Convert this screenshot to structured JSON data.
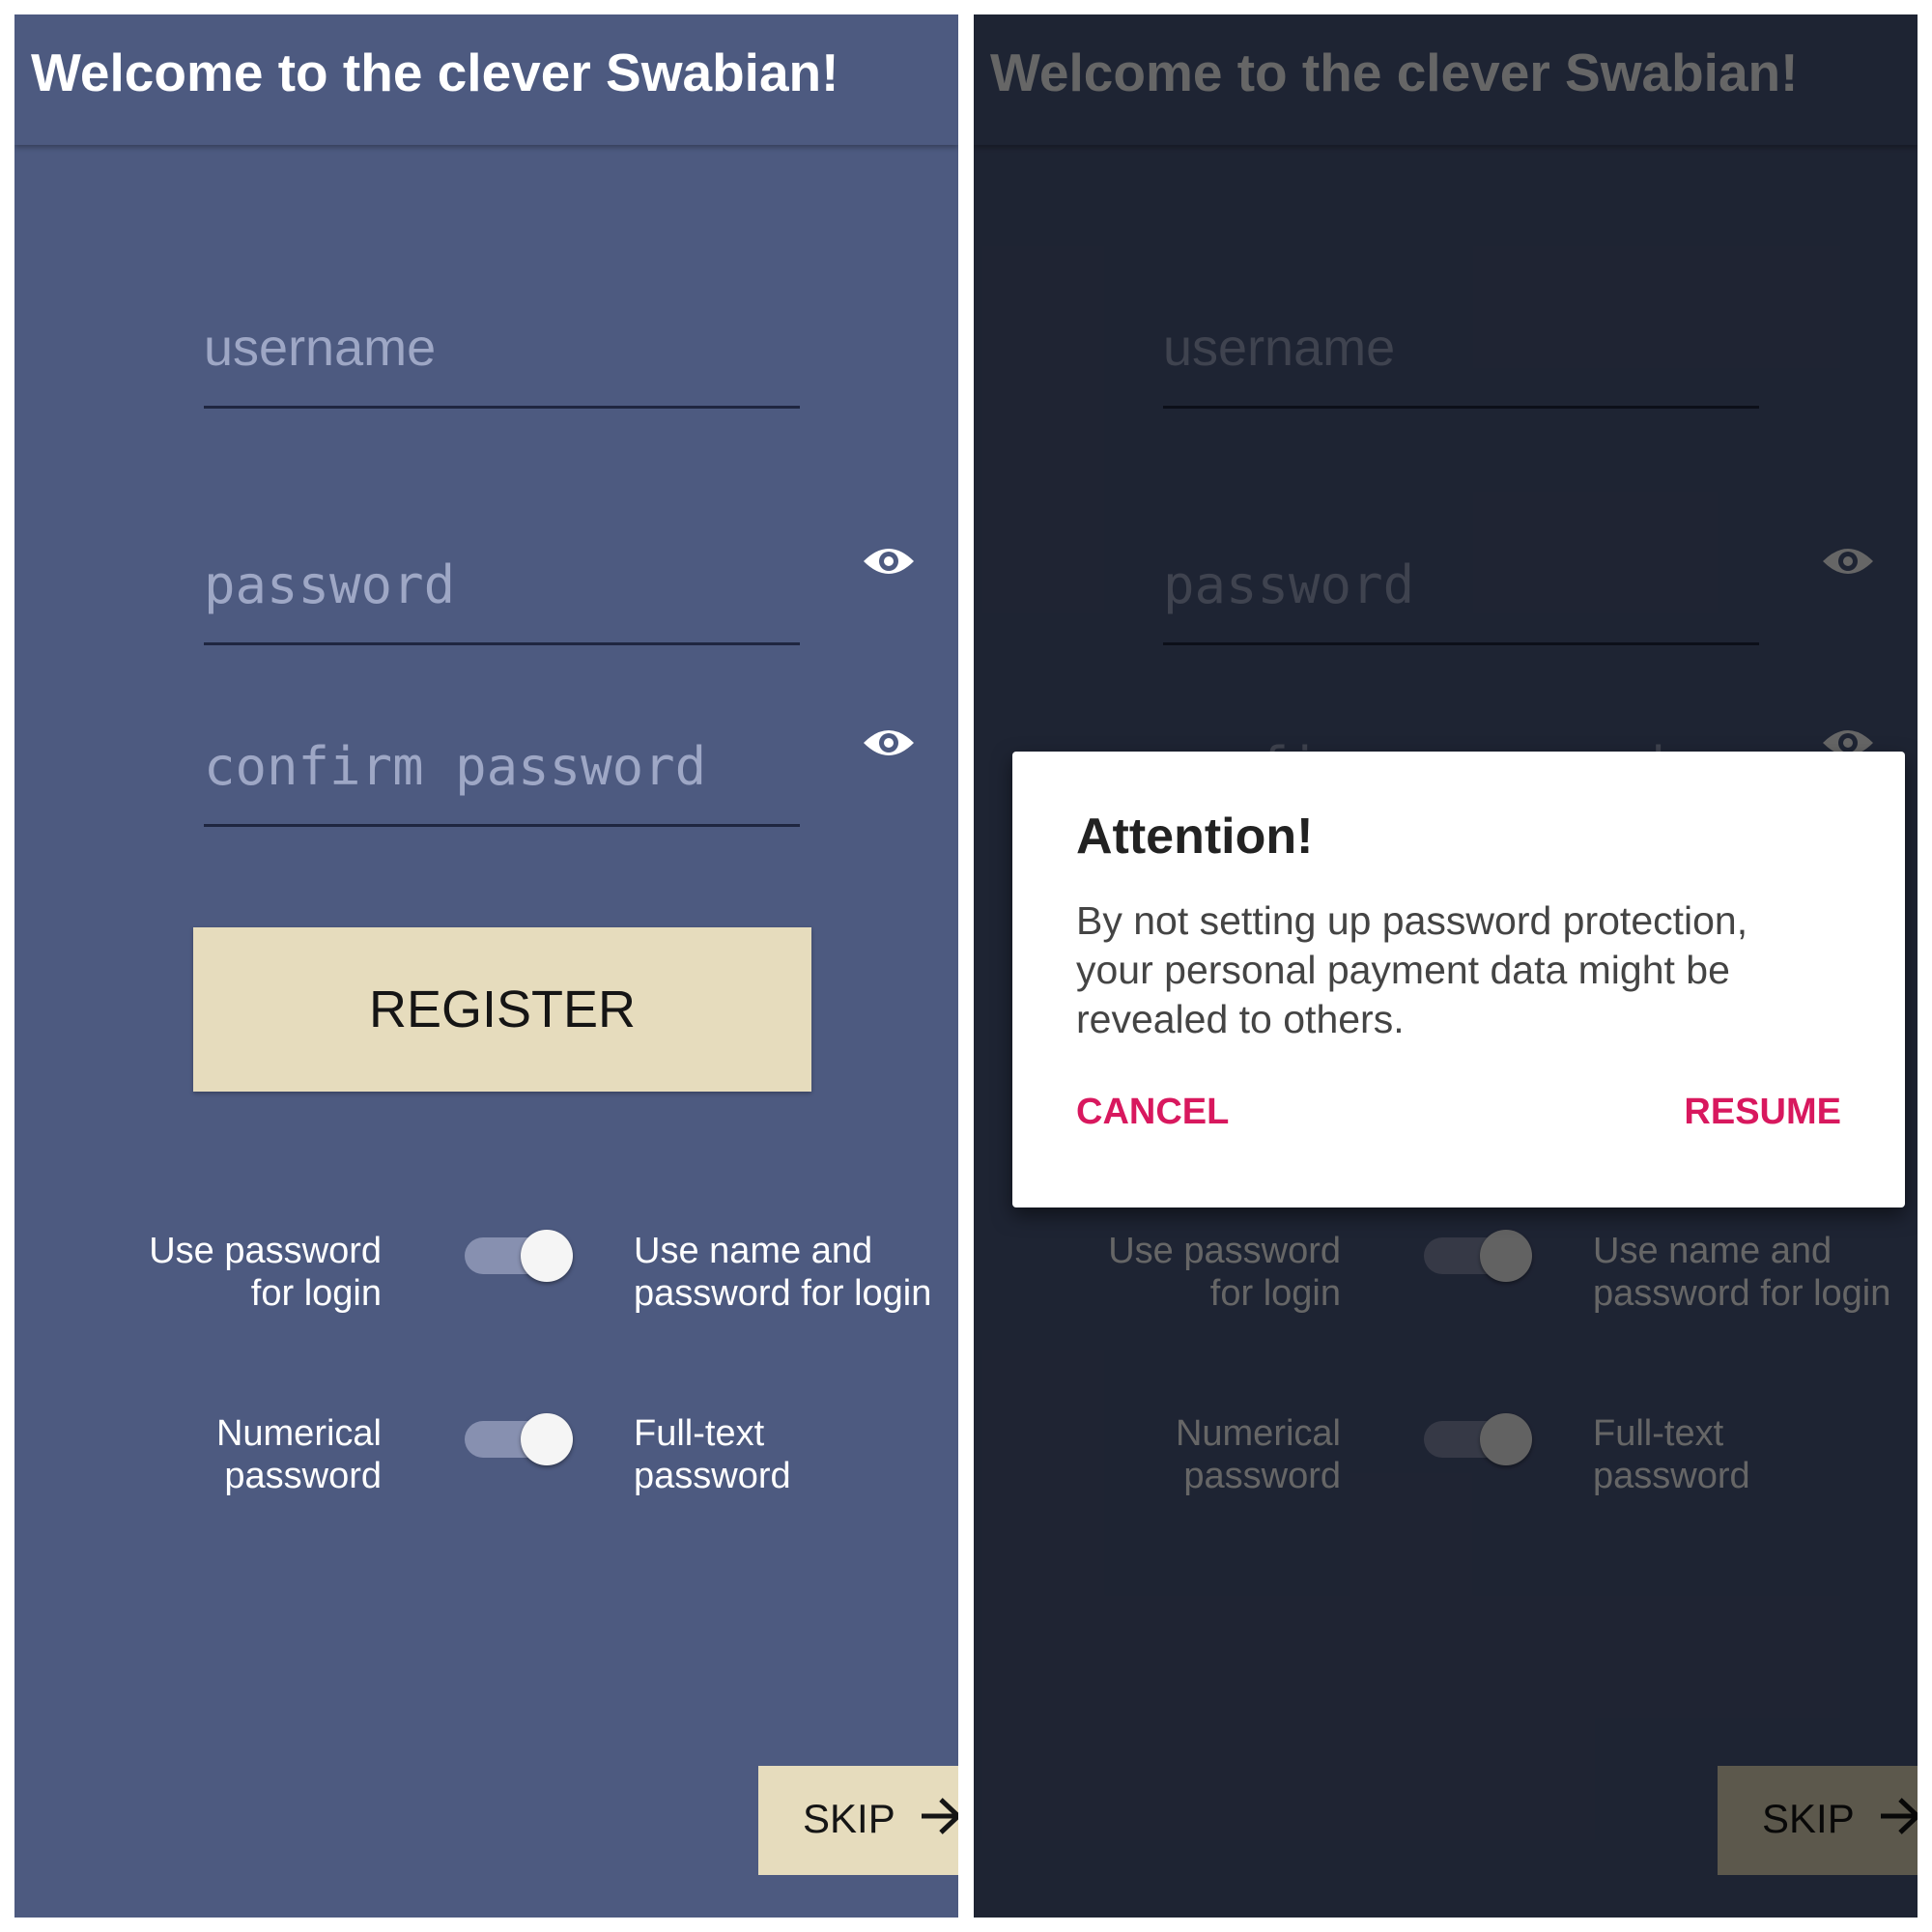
{
  "app": {
    "title": "Welcome to the clever Swabian!"
  },
  "form": {
    "username_placeholder": "username",
    "password_placeholder": "password",
    "confirm_placeholder": "confirm password",
    "register_label": "REGISTER"
  },
  "options": {
    "login_left_line1": "Use password",
    "login_left_line2": "for login",
    "login_right_line1": "Use name and",
    "login_right_line2": "password for login",
    "pwtype_left_line1": "Numerical",
    "pwtype_left_line2": "password",
    "pwtype_right_line1": "Full-text",
    "pwtype_right_line2": "password"
  },
  "skip": {
    "label": "SKIP"
  },
  "dialog": {
    "title": "Attention!",
    "message_line1": "By not setting up password protection,",
    "message_line2": "your personal payment data might be",
    "message_line3": "revealed to others.",
    "cancel_label": "CANCEL",
    "resume_label": "RESUME"
  },
  "colors": {
    "background": "#4d5a80",
    "button": "#e6dcbd",
    "dialog_accent": "#d8185e"
  },
  "icons": {
    "visibility": "eye-icon",
    "skip": "arrow-right-icon"
  }
}
